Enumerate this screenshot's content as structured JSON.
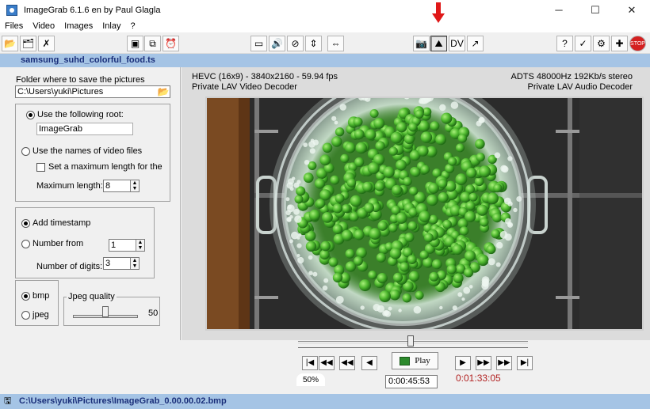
{
  "window": {
    "title": "ImageGrab 6.1.6 en by Paul Glagla",
    "minimize": "─",
    "maximize": "☐",
    "close": "✕"
  },
  "menu": [
    "Files",
    "Video",
    "Images",
    "Inlay",
    "?"
  ],
  "file": {
    "name": "samsung_suhd_colorful_food.ts"
  },
  "left": {
    "folder_label": "Folder where to save the pictures",
    "folder_path": "C:\\Users\\yuki\\Pictures",
    "use_root_label": "Use the following root:",
    "root_value": "ImageGrab",
    "use_names_label": "Use the names of video files",
    "set_max_label": "Set a maximum length for the",
    "max_length_label": "Maximum length:",
    "max_length_value": "8",
    "add_timestamp_label": "Add timestamp",
    "number_from_label": "Number from",
    "number_from_value": "1",
    "digits_label": "Number of digits:",
    "digits_value": "3",
    "bmp_label": "bmp",
    "jpeg_label": "jpeg",
    "jpeg_quality_label": "Jpeg quality",
    "jpeg_quality_value": "50",
    "jpeg_quality_fraction": 0.5
  },
  "info": {
    "video_line1": "HEVC (16x9) - 3840x2160 - 59.94 fps",
    "video_line2": "Private LAV Video Decoder",
    "audio_line1": "ADTS 48000Hz 192Kb/s stereo",
    "audio_line2": "Private LAV Audio Decoder"
  },
  "player": {
    "play_label": "Play",
    "zoom": "50%",
    "current_time": "0:00:45:53",
    "duration": "0:01:33:05",
    "position_fraction": 0.49
  },
  "status": {
    "path": "C:\\Users\\yuki\\Pictures\\ImageGrab_0.00.00.02.bmp"
  },
  "colors": {
    "accent_band": "#a5c4e5",
    "duration_text": "#b22222",
    "pea_green": "#5cc43a"
  }
}
